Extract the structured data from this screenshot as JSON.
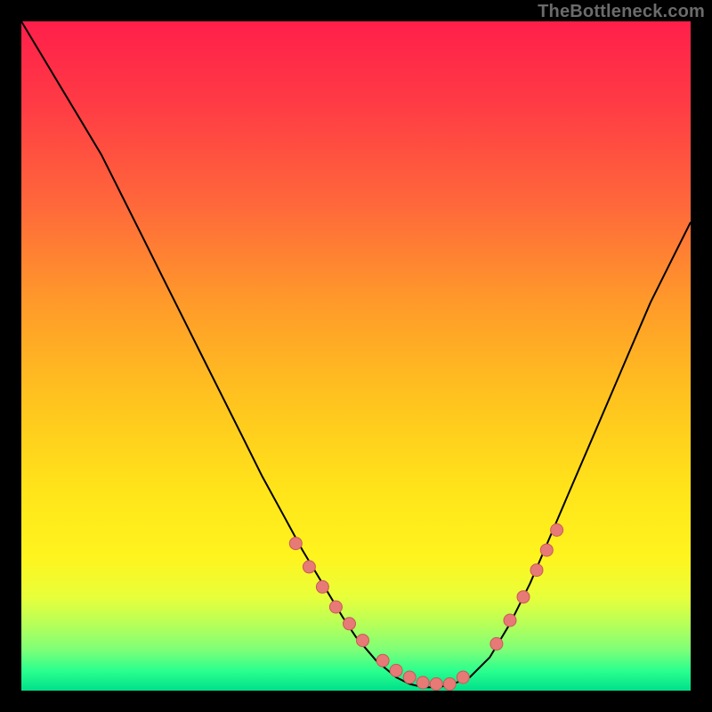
{
  "watermark": "TheBottleneck.com",
  "colors": {
    "bg": "#000000",
    "curve": "#000000",
    "marker_fill": "#e77a76",
    "marker_stroke": "#c85a56"
  },
  "chart_data": {
    "type": "line",
    "title": "",
    "xlabel": "",
    "ylabel": "",
    "xlim": [
      0,
      100
    ],
    "ylim": [
      0,
      100
    ],
    "x": [
      0,
      3,
      6,
      9,
      12,
      15,
      18,
      21,
      24,
      27,
      30,
      33,
      36,
      39,
      42,
      45,
      48,
      50,
      53,
      56,
      58,
      60,
      62,
      64,
      67,
      70,
      73,
      76,
      79,
      82,
      85,
      88,
      91,
      94,
      97,
      100
    ],
    "y": [
      100,
      95,
      90,
      85,
      80,
      74,
      68,
      62,
      56,
      50,
      44,
      38,
      32,
      26.5,
      21,
      16,
      11,
      8,
      4.5,
      2,
      1,
      0.5,
      0.5,
      0.8,
      2,
      5,
      10,
      16,
      23,
      30,
      37,
      44,
      51,
      58,
      64,
      70
    ],
    "markers": {
      "x": [
        41,
        43,
        45,
        47,
        49,
        51,
        54,
        56,
        58,
        60,
        62,
        64,
        66,
        71,
        73,
        75,
        77,
        78.5,
        80
      ],
      "y": [
        22,
        18.5,
        15.5,
        12.5,
        10,
        7.5,
        4.5,
        3,
        2,
        1.2,
        1,
        1,
        2,
        7,
        10.5,
        14,
        18,
        21,
        24
      ]
    }
  }
}
